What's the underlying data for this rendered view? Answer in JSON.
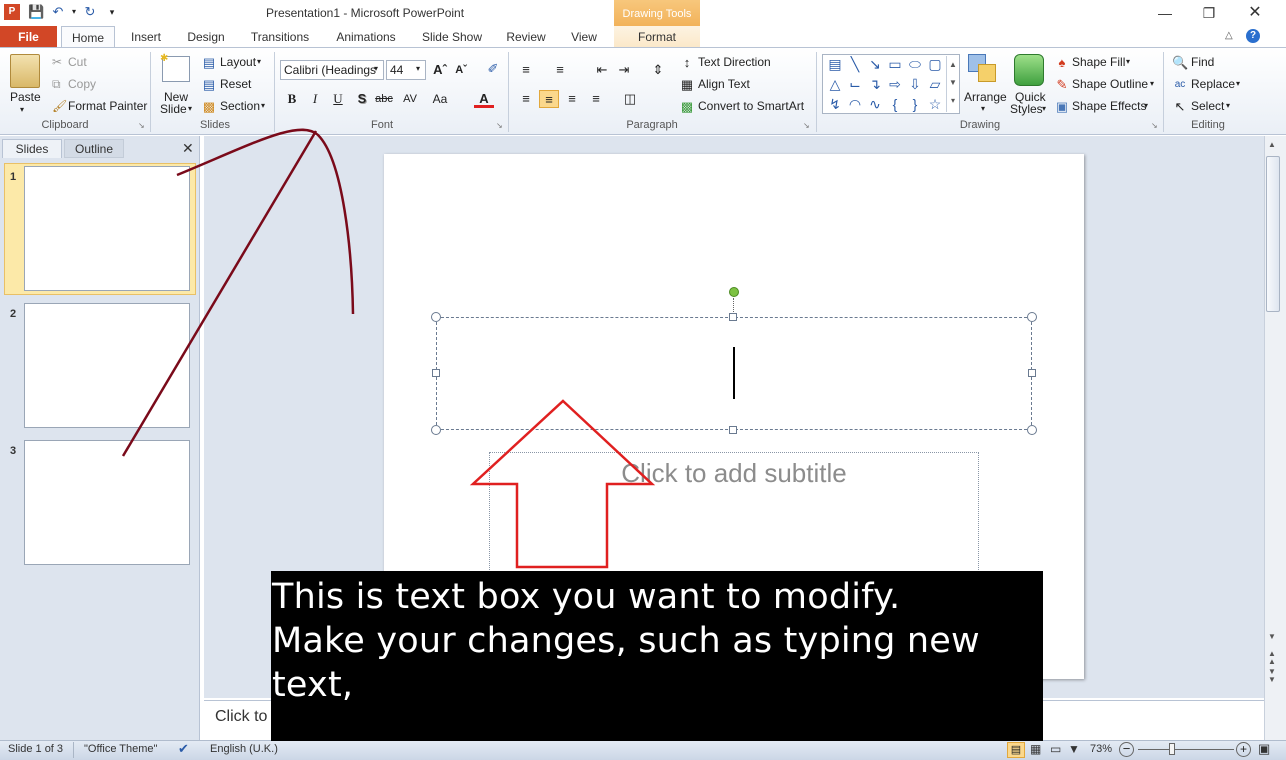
{
  "window": {
    "title": "Presentation1  -  Microsoft PowerPoint",
    "contextual_header": "Drawing Tools"
  },
  "tabs": [
    "File",
    "Home",
    "Insert",
    "Design",
    "Transitions",
    "Animations",
    "Slide Show",
    "Review",
    "View",
    "Format"
  ],
  "ribbon": {
    "clipboard": {
      "label": "Clipboard",
      "paste": "Paste",
      "cut": "Cut",
      "copy": "Copy",
      "format_painter": "Format Painter"
    },
    "slides": {
      "label": "Slides",
      "new_slide_1": "New",
      "new_slide_2": "Slide",
      "layout": "Layout",
      "reset": "Reset",
      "section": "Section"
    },
    "font": {
      "label": "Font",
      "font_name": "Calibri (Headings",
      "font_size": "44"
    },
    "paragraph": {
      "label": "Paragraph",
      "text_direction": "Text Direction",
      "align_text": "Align Text",
      "convert_smartart": "Convert to SmartArt"
    },
    "drawing": {
      "label": "Drawing",
      "arrange": "Arrange",
      "quick_styles_1": "Quick",
      "quick_styles_2": "Styles",
      "shape_fill": "Shape Fill",
      "shape_outline": "Shape Outline",
      "shape_effects": "Shape Effects"
    },
    "editing": {
      "label": "Editing",
      "find": "Find",
      "replace": "Replace",
      "select": "Select"
    }
  },
  "left_pane": {
    "tabs": [
      "Slides",
      "Outline"
    ],
    "slide_numbers": [
      "1",
      "2",
      "3"
    ]
  },
  "slide": {
    "subtitle_placeholder": "Click to add subtitle"
  },
  "notes": {
    "placeholder": "Click to"
  },
  "status": {
    "slide_info": "Slide 1 of 3",
    "theme": "\"Office Theme\"",
    "language": "English (U.K.)",
    "zoom": "73%"
  },
  "caption": {
    "line1": "This is text box you want to modify.",
    "line2": "Make your changes, such as typing new",
    "line3": "text,"
  },
  "colors": {
    "file_tab": "#d24726",
    "annotation_arrow": "#e02020",
    "annotation_curve": "#7a0a1a",
    "rotate_handle": "#7dc243"
  }
}
